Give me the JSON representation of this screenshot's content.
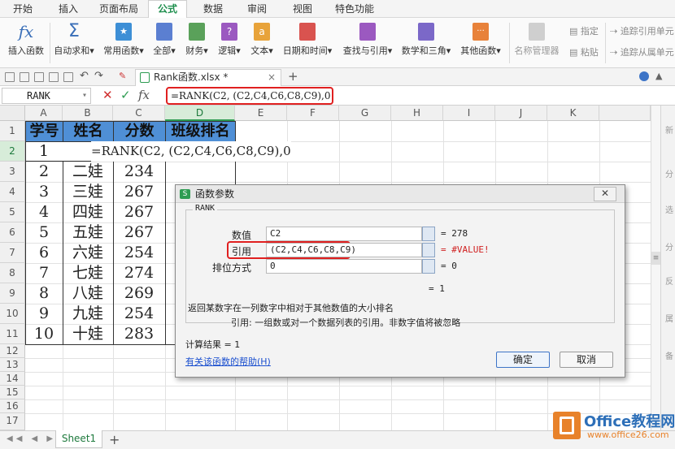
{
  "ribbon_tabs": [
    "开始",
    "插入",
    "页面布局",
    "公式",
    "数据",
    "审阅",
    "视图",
    "特色功能"
  ],
  "active_tab": "公式",
  "ribbon_buttons": [
    "插入函数",
    "自动求和",
    "常用函数",
    "全部",
    "财务",
    "逻辑",
    "文本",
    "日期和时间",
    "查找与引用",
    "数学和三角",
    "其他函数",
    "名称管理器"
  ],
  "ribbon_small": [
    "指定",
    "粘贴",
    "追踪引用单元",
    "追踪从属单元"
  ],
  "doc_tab": "Rank函数.xlsx *",
  "name_box": "RANK",
  "formula": "=RANK(C2, (C2,C4,C6,C8,C9),0",
  "columns": [
    "A",
    "B",
    "C",
    "D",
    "E",
    "F",
    "G",
    "H",
    "I",
    "J",
    "K"
  ],
  "rows": [
    "1",
    "2",
    "3",
    "4",
    "5",
    "6",
    "7",
    "8",
    "9",
    "10",
    "11",
    "12",
    "13",
    "14",
    "15",
    "16",
    "17"
  ],
  "table_header": [
    "学号",
    "姓名",
    "分数",
    "班级排名"
  ],
  "table_rows": [
    {
      "id": "1",
      "name": "",
      "score": ""
    },
    {
      "id": "2",
      "name": "二娃",
      "score": "234"
    },
    {
      "id": "3",
      "name": "三娃",
      "score": "267"
    },
    {
      "id": "4",
      "name": "四娃",
      "score": "267"
    },
    {
      "id": "5",
      "name": "五娃",
      "score": "267"
    },
    {
      "id": "6",
      "name": "六娃",
      "score": "254"
    },
    {
      "id": "7",
      "name": "七娃",
      "score": "274"
    },
    {
      "id": "8",
      "name": "八娃",
      "score": "269"
    },
    {
      "id": "9",
      "name": "九娃",
      "score": "254"
    },
    {
      "id": "10",
      "name": "十娃",
      "score": "283"
    }
  ],
  "row2_formula": "=RANK(C2, (C2,C4,C6,C8,C9),0",
  "right_panel": [
    "新",
    "分",
    "选",
    "分",
    "反",
    "属",
    "备"
  ],
  "sheet_tab": "Sheet1",
  "add_sheet": "+",
  "dialog": {
    "title": "函数参数",
    "func_name": "RANK",
    "params": [
      {
        "label": "数值",
        "value": "C2",
        "result": "= 278"
      },
      {
        "label": "引用",
        "value": "(C2,C4,C6,C8,C9)",
        "result": "= #VALUE!"
      },
      {
        "label": "排位方式",
        "value": "0",
        "result": "= 0"
      }
    ],
    "overall_result": "= 1",
    "description": "返回某数字在一列数字中相对于其他数值的大小排名",
    "param_help": "引用:  一组数或对一个数据列表的引用。非数字值将被忽略",
    "calc_result": "计算结果 = 1",
    "help_link": "有关该函数的帮助(H)",
    "ok": "确定",
    "cancel": "取消"
  },
  "logo": {
    "brand": "Office教程网",
    "url": "www.office26.com"
  },
  "colors": {
    "accent": "#1f8f4e",
    "header_fill": "#4f8fd6",
    "highlight": "#e02020"
  }
}
